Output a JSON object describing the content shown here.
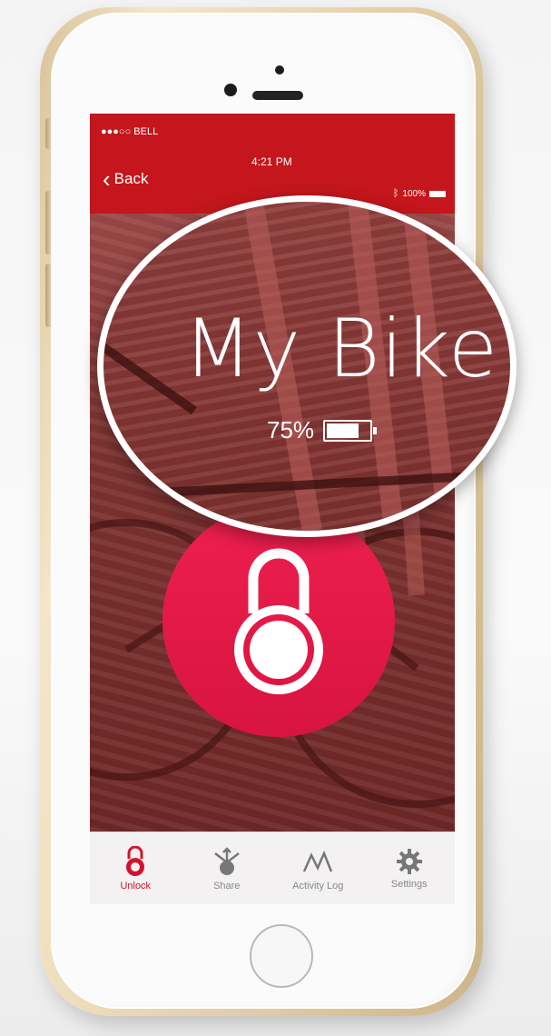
{
  "status_bar": {
    "carrier": "●●●○○ BELL",
    "time": "4:21 PM",
    "battery": "100%"
  },
  "nav": {
    "back_label": "Back"
  },
  "device": {
    "name": "My Bike",
    "battery_text": "75%",
    "battery_level": 0.75
  },
  "tabs": [
    {
      "label": "Unlock",
      "icon": "unlock-icon",
      "active": true
    },
    {
      "label": "Share",
      "icon": "share-icon",
      "active": false
    },
    {
      "label": "Activity Log",
      "icon": "activity-log-icon",
      "active": false
    },
    {
      "label": "Settings",
      "icon": "gear-icon",
      "active": false
    }
  ],
  "colors": {
    "accent": "#c4161c",
    "lock_button": "#e8174a",
    "tab_active": "#d0142e"
  }
}
